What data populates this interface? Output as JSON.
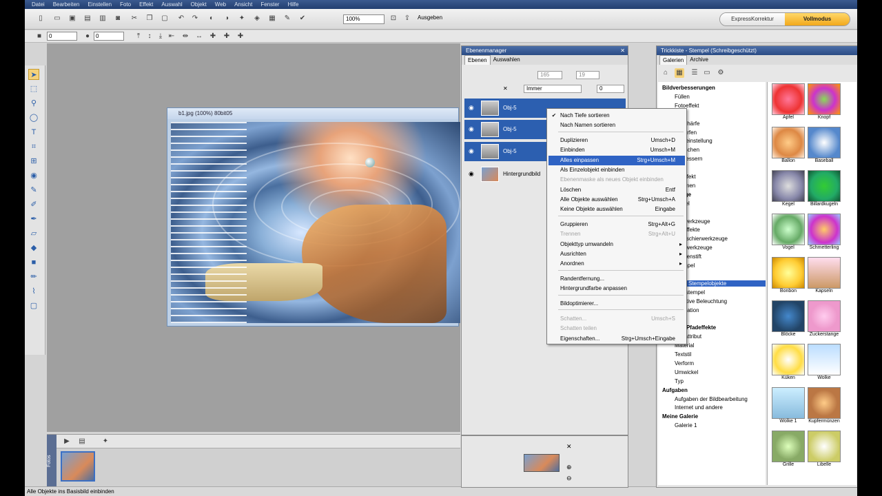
{
  "menu": [
    "Datei",
    "Bearbeiten",
    "Einstellen",
    "Foto",
    "Effekt",
    "Auswahl",
    "Objekt",
    "Web",
    "Ansicht",
    "Fenster",
    "Hilfe"
  ],
  "toolbar": {
    "zoom": "100%",
    "output": "Ausgeben"
  },
  "modes": {
    "express": "ExpressKorrektur",
    "full": "Vollmodus"
  },
  "options": {
    "value1": "0",
    "value2": "0"
  },
  "document": {
    "title": "b1.jpg (100%) 80bit05"
  },
  "layers_panel": {
    "title": "Ebenenmanager",
    "tabs": [
      "Ebenen",
      "Auswahlen"
    ],
    "fields": {
      "x": "165",
      "y": "19",
      "mode": "Immer",
      "opacity": "0"
    },
    "layers": [
      {
        "name": "Obj-5"
      },
      {
        "name": "Obj-5"
      },
      {
        "name": "Obj-5"
      },
      {
        "name": "Hintergrundbild"
      }
    ]
  },
  "context_menu": {
    "items": [
      {
        "label": "Nach Tiefe sortieren",
        "shortcut": "",
        "state": "checked"
      },
      {
        "label": "Nach Namen sortieren",
        "shortcut": "",
        "state": "normal"
      },
      {
        "label": "Duplizieren",
        "shortcut": "Umsch+D",
        "state": "normal"
      },
      {
        "label": "Einbinden",
        "shortcut": "Umsch+M",
        "state": "normal"
      },
      {
        "label": "Alles einpassen",
        "shortcut": "Strg+Umsch+M",
        "state": "highlighted"
      },
      {
        "label": "Als Einzelobjekt einbinden",
        "shortcut": "",
        "state": "normal"
      },
      {
        "label": "Ebenenmaske als neues Objekt einbinden",
        "shortcut": "",
        "state": "disabled"
      },
      {
        "label": "Löschen",
        "shortcut": "Entf",
        "state": "normal"
      },
      {
        "label": "Alle Objekte auswählen",
        "shortcut": "Strg+Umsch+A",
        "state": "normal"
      },
      {
        "label": "Keine Objekte auswählen",
        "shortcut": "Eingabe",
        "state": "normal"
      },
      {
        "label": "Gruppieren",
        "shortcut": "Strg+Alt+G",
        "state": "normal"
      },
      {
        "label": "Trennen",
        "shortcut": "Strg+Alt+U",
        "state": "disabled"
      },
      {
        "label": "Objekttyp umwandeln",
        "shortcut": "",
        "state": "submenu"
      },
      {
        "label": "Ausrichten",
        "shortcut": "",
        "state": "submenu"
      },
      {
        "label": "Anordnen",
        "shortcut": "",
        "state": "submenu"
      },
      {
        "label": "Randentfernung...",
        "shortcut": "",
        "state": "normal"
      },
      {
        "label": "Hintergrundfarbe anpassen",
        "shortcut": "",
        "state": "normal"
      },
      {
        "label": "Bildoptimierer...",
        "shortcut": "",
        "state": "normal"
      },
      {
        "label": "Schatten...",
        "shortcut": "Umsch+S",
        "state": "disabled"
      },
      {
        "label": "Schatten teilen",
        "shortcut": "",
        "state": "disabled"
      },
      {
        "label": "Eigenschaften...",
        "shortcut": "Strg+Umsch+Eingabe",
        "state": "normal"
      }
    ]
  },
  "trick_panel": {
    "title": "Trickkiste - Stempel (Schreibgeschützt)",
    "tabs": [
      "Galerien",
      "Archive"
    ],
    "tree": [
      {
        "label": "Bildverbesserungen",
        "bold": true
      },
      {
        "label": "Füllen"
      },
      {
        "label": "Fotoeffekt"
      },
      {
        "label": "Alle"
      },
      {
        "label": "Unschärfe"
      },
      {
        "label": "Schärfen"
      },
      {
        "label": "Farbeinstellung"
      },
      {
        "label": "Rauschen"
      },
      {
        "label": "Verbessern"
      },
      {
        "label": "Filter"
      },
      {
        "label": "Stileffekt"
      },
      {
        "label": "Rahmen"
      },
      {
        "label": "Werkzeuge",
        "bold": true
      },
      {
        "label": "Pinsel"
      },
      {
        "label": "Alle"
      },
      {
        "label": "Malwerkzeuge"
      },
      {
        "label": "Maleffekte"
      },
      {
        "label": "Retuschierwerkzeuge"
      },
      {
        "label": "Klonwerkzeuge"
      },
      {
        "label": "Wolkenstift"
      },
      {
        "label": "Stempel"
      },
      {
        "label": "Alle"
      },
      {
        "label": "Stempelobjekte",
        "selected": true
      },
      {
        "label": "Klonstempel"
      },
      {
        "label": "Kreative Beleuchtung"
      },
      {
        "label": "Animation"
      },
      {
        "label": "Kopf"
      },
      {
        "label": "Text und Pfadeffekte",
        "bold": true
      },
      {
        "label": "Textattribut"
      },
      {
        "label": "Material"
      },
      {
        "label": "Textstil"
      },
      {
        "label": "Verform"
      },
      {
        "label": "Umwickel"
      },
      {
        "label": "Typ"
      },
      {
        "label": "Aufgaben",
        "bold": true
      },
      {
        "label": "Aufgaben der Bildbearbeitung"
      },
      {
        "label": "Internet und andere"
      },
      {
        "label": "Meine Galerie",
        "bold": true
      },
      {
        "label": "Galerie 1"
      }
    ],
    "gallery": [
      "Apfel",
      "Knopf",
      "Ballon",
      "Baseball",
      "Kegel",
      "Billardkugeln",
      "Vogel",
      "Schmetterling",
      "Bonbon",
      "Kapseln",
      "Blöcke",
      "Zuckerstange",
      "Küken",
      "Wolke",
      "Wolke 1",
      "Kupfermünzen",
      "Grille",
      "Libelle"
    ]
  },
  "status": "Alle Objekte ins Basisbild einbinden",
  "bin": {
    "label": "Fotos"
  }
}
